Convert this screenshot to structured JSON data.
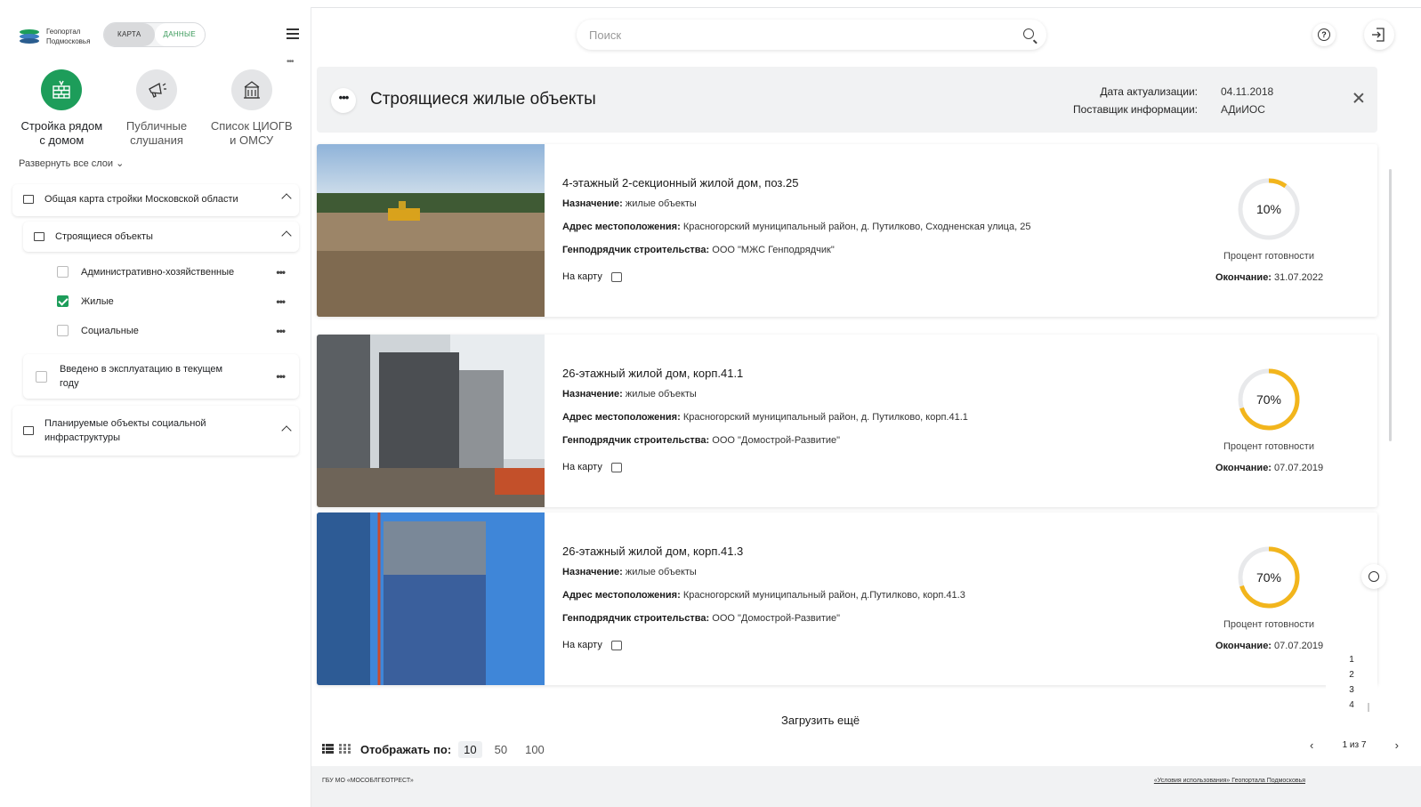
{
  "app": {
    "logo_line1": "Геопортал",
    "logo_line2": "Подмосковья",
    "toggle_map": "КАРТА",
    "toggle_data": "ДАННЫЕ"
  },
  "categories": [
    {
      "label_line1": "Стройка рядом",
      "label_line2": "с домом",
      "icon": "bricks-icon",
      "active": true
    },
    {
      "label_line1": "Публичные",
      "label_line2": "слушания",
      "icon": "megaphone-icon",
      "active": false
    },
    {
      "label_line1": "Список ЦИОГВ",
      "label_line2": "и ОМСУ",
      "icon": "building-icon",
      "active": false
    }
  ],
  "sidebar": {
    "expand_all": "Развернуть все слои",
    "group1": "Общая карта стройки Московской области",
    "group1_sub": "Строящиеся объекты",
    "layers": [
      {
        "label": "Административно-хозяйственные",
        "checked": false
      },
      {
        "label": "Жилые",
        "checked": true
      },
      {
        "label": "Социальные",
        "checked": false
      }
    ],
    "group2_line1": "Введено в эксплуатацию в текущем",
    "group2_line2": "году",
    "group3_line1": "Планируемые объекты социальной",
    "group3_line2": "инфраструктуры"
  },
  "search": {
    "placeholder": "Поиск"
  },
  "header": {
    "title": "Строящиеся жилые объекты",
    "date_label": "Дата актуализации:",
    "date_value": "04.11.2018",
    "provider_label": "Поставщик информации:",
    "provider_value": "АДиИОС"
  },
  "labels": {
    "purpose": "Назначение:",
    "address": "Адрес местоположения:",
    "contractor": "Генподрядчик строительства:",
    "to_map": "На карту",
    "readiness": "Процент готовности",
    "end": "Окончание:"
  },
  "objects": [
    {
      "title": "4-этажный 2-секционный жилой дом, поз.25",
      "purpose": "жилые объекты",
      "address": "Красногорский муниципальный район, д. Путилково, Сходненская улица, 25",
      "contractor": "ООО \"МЖС Генподрядчик\"",
      "percent": 10,
      "percent_text": "10%",
      "end_date": "31.07.2022"
    },
    {
      "title": "26-этажный жилой дом, корп.41.1",
      "purpose": "жилые объекты",
      "address": "Красногорский муниципальный район, д. Путилково, корп.41.1",
      "contractor": "ООО \"Домострой-Развитие\"",
      "percent": 70,
      "percent_text": "70%",
      "end_date": "07.07.2019"
    },
    {
      "title": "26-этажный жилой дом, корп.41.3",
      "purpose": "жилые объекты",
      "address": "Красногорский муниципальный район, д.Путилково, корп.41.3",
      "contractor": "ООО \"Домострой-Развитие\"",
      "percent": 70,
      "percent_text": "70%",
      "end_date": "07.07.2019"
    }
  ],
  "bottom": {
    "load_more": "Загрузить ещё",
    "per_page_label": "Отображать по:",
    "per_page_options": [
      "10",
      "50",
      "100"
    ],
    "per_page_selected": "10"
  },
  "pager": {
    "pages": [
      "1",
      "2",
      "3",
      "4"
    ],
    "current": "1 из 7"
  },
  "footer": {
    "left": "ГБУ МО «МОСОБЛГЕОТРЕСТ»",
    "right": "«Условия использования» Геопортала Подмосковья"
  },
  "colors": {
    "accent": "#1d9d5a",
    "ring": "#f2b51c",
    "ring_bg": "#e8e9eb"
  }
}
